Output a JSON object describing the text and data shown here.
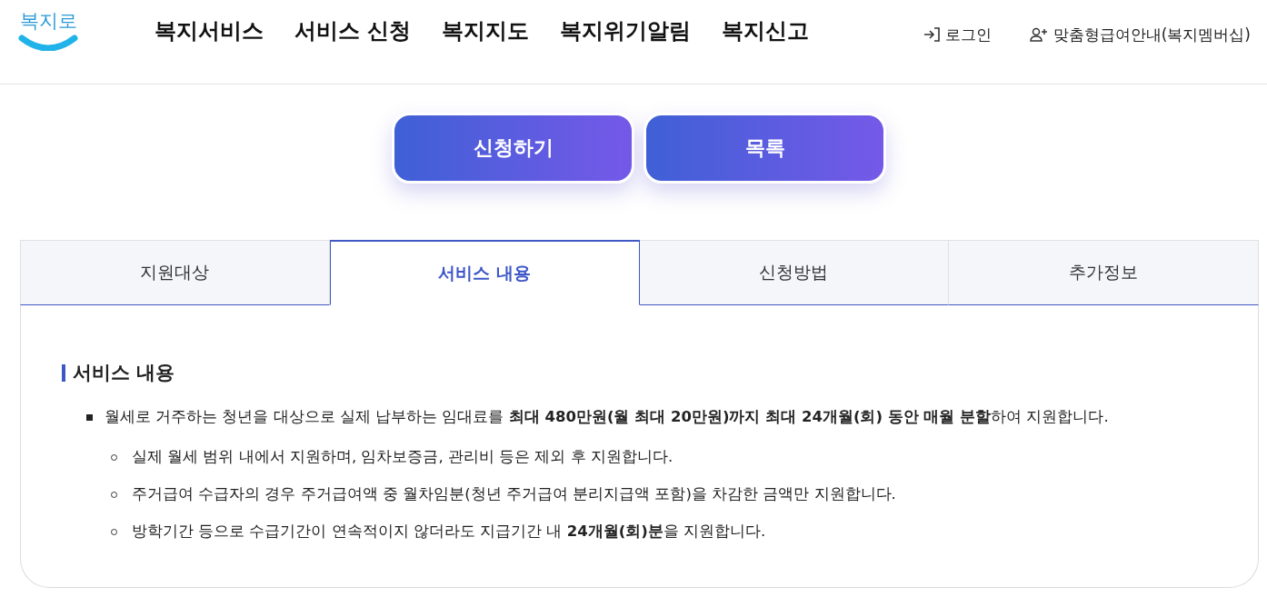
{
  "header": {
    "logo": "복지로",
    "nav": [
      "복지서비스",
      "서비스 신청",
      "복지지도",
      "복지위기알림",
      "복지신고"
    ],
    "utility_links": [
      {
        "kind": "login",
        "label": "로그인"
      },
      {
        "kind": "membership",
        "label": "맞춤형급여안내(복지멤버십)"
      }
    ]
  },
  "actions": [
    {
      "label": "신청하기"
    },
    {
      "label": "목록"
    }
  ],
  "tabs": [
    {
      "label": "지원대상",
      "selected": false
    },
    {
      "label": "서비스 내용",
      "selected": true
    },
    {
      "label": "신청방법",
      "selected": false
    },
    {
      "label": "추가정보",
      "selected": false
    }
  ],
  "section": {
    "title": "서비스 내용",
    "items": [
      {
        "text": "월세로 거주하는 청년을 대상으로 실제 납부하는 임대료를 **최대 480만원(월 최대 20만원)까지 최대 24개월(회) 동안 매월 분할**하여 지원합니다.",
        "children": [
          {
            "text": "실제 월세 범위 내에서 지원하며, 임차보증금, 관리비 등은 제외 후 지원합니다."
          },
          {
            "text": "주거급여 수급자의 경우 주거급여액 중 월차임분(청년 주거급여 분리지급액 포함)을 차감한 금액만 지원합니다."
          },
          {
            "text": "방학기간 등으로 수급기간이 연속적이지 않더라도 지급기간 내 **24개월(회)분**을 지원합니다."
          }
        ]
      }
    ]
  }
}
